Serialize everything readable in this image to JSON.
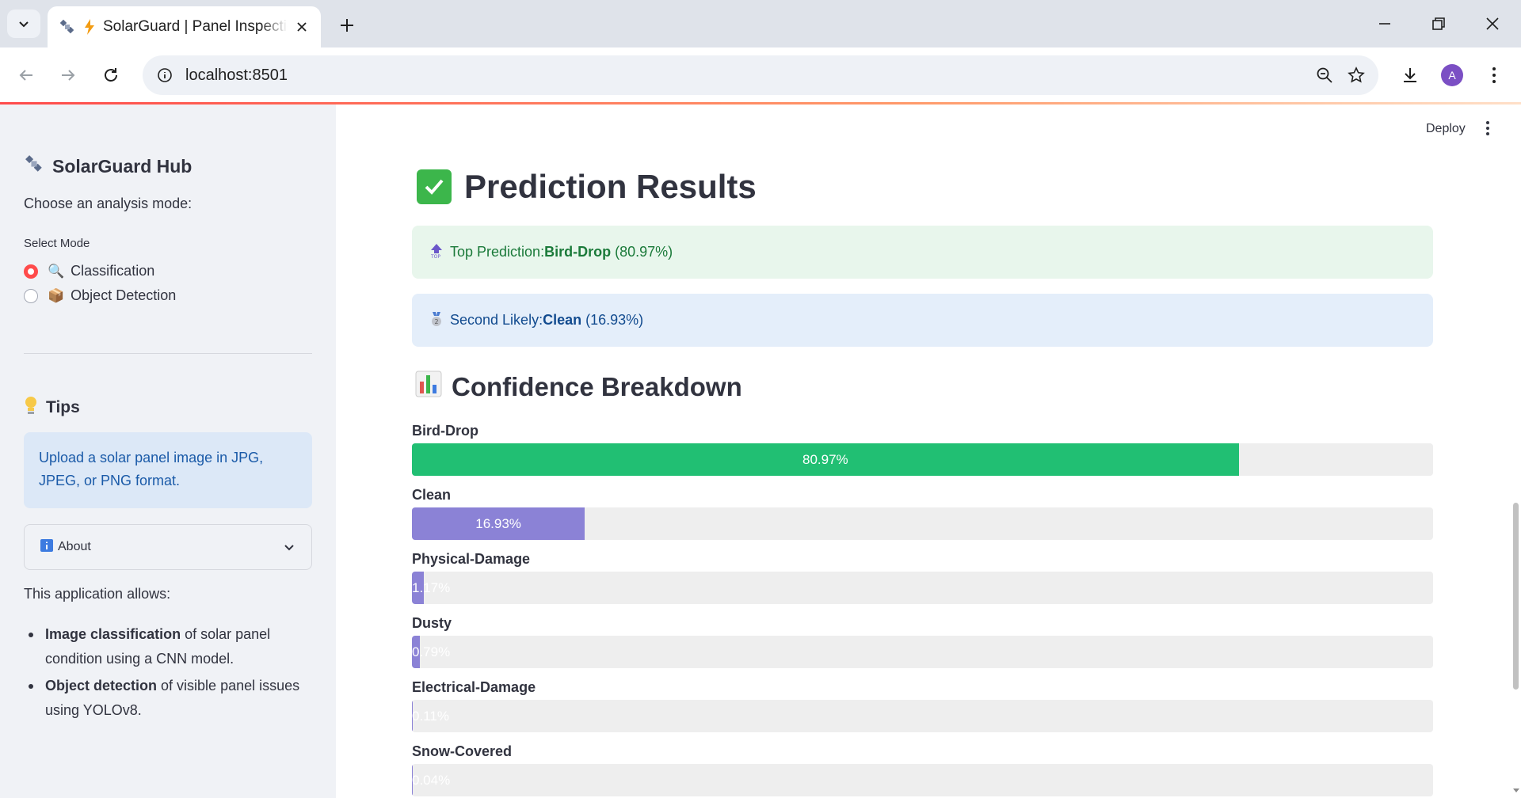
{
  "browser": {
    "tab_title": "SolarGuard | Panel Inspection",
    "url": "localhost:8501",
    "avatar_letter": "A"
  },
  "sidebar": {
    "title": "SolarGuard Hub",
    "subtitle": "Choose an analysis mode:",
    "select_label": "Select Mode",
    "modes": [
      {
        "emoji": "🔍",
        "label": "Classification",
        "selected": true
      },
      {
        "emoji": "📦",
        "label": "Object Detection",
        "selected": false
      }
    ],
    "tips_title": "Tips",
    "tips_text": "Upload a solar panel image in JPG, JPEG, or PNG format.",
    "about_label": "About",
    "about_intro": "This application allows:",
    "about_items": [
      {
        "bold": "Image classification",
        "rest": " of solar panel condition using a CNN model."
      },
      {
        "bold": "Object detection",
        "rest": " of visible panel issues using YOLOv8."
      }
    ]
  },
  "main": {
    "deploy_label": "Deploy",
    "heading": "Prediction Results",
    "top_prediction": {
      "prefix": "Top Prediction: ",
      "class": "Bird-Drop",
      "pct": "(80.97%)"
    },
    "second_prediction": {
      "prefix": "Second Likely: ",
      "class": "Clean",
      "pct": "(16.93%)"
    },
    "breakdown_heading": "Confidence Breakdown",
    "bars": [
      {
        "label": "Bird-Drop",
        "value": 80.97,
        "text": "80.97%",
        "color": "#21bf73"
      },
      {
        "label": "Clean",
        "value": 16.93,
        "text": "16.93%",
        "color": "#8b82d6"
      },
      {
        "label": "Physical-Damage",
        "value": 1.17,
        "text": "1.17%",
        "color": "#8b82d6"
      },
      {
        "label": "Dusty",
        "value": 0.79,
        "text": "0.79%",
        "color": "#8b82d6"
      },
      {
        "label": "Electrical-Damage",
        "value": 0.11,
        "text": "0.11%",
        "color": "#8b82d6"
      },
      {
        "label": "Snow-Covered",
        "value": 0.04,
        "text": "0.04%",
        "color": "#8b82d6"
      }
    ]
  }
}
